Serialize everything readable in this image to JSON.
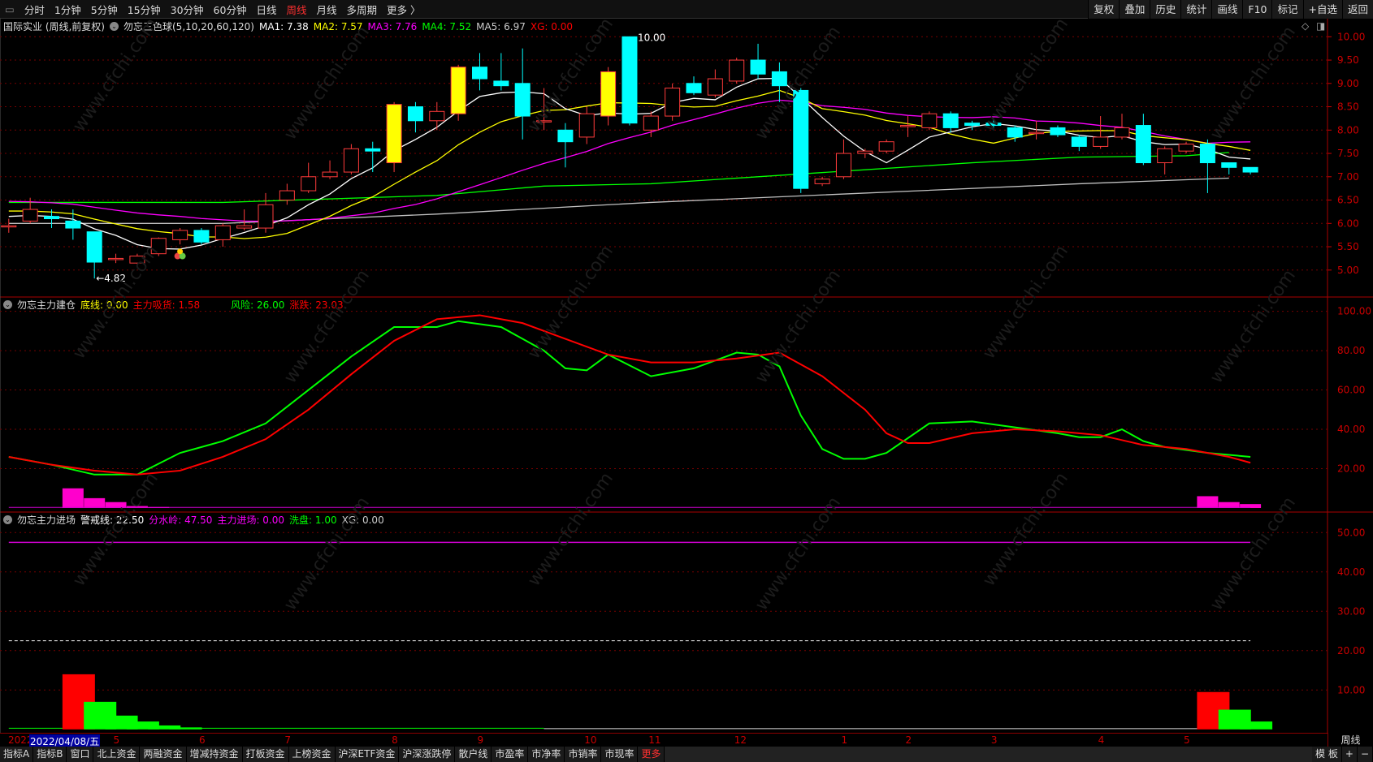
{
  "toolbar": {
    "tabs": [
      "分时",
      "1分钟",
      "5分钟",
      "15分钟",
      "30分钟",
      "60分钟",
      "日线",
      "周线",
      "月线",
      "多周期",
      "更多 〉"
    ],
    "active": "周线",
    "right": [
      "复权",
      "叠加",
      "历史",
      "统计",
      "画线",
      "F10",
      "标记",
      "+自选",
      "返回"
    ]
  },
  "price_legend": {
    "title": "国际实业 (周线,前复权)",
    "indicator": "勿忘三色球(5,10,20,60,120)",
    "ma1": "MA1: 7.38",
    "ma2": "MA2: 7.57",
    "ma3": "MA3: 7.76",
    "ma4": "MA4: 7.52",
    "ma5": "MA5: 6.97",
    "xg": "XG: 0.00"
  },
  "ind1_legend": {
    "title": "勿忘主力建仓",
    "dixian": "底线: 0.00",
    "xihuo": "主力吸货: 1.58",
    "fengxian": "风险: 26.00",
    "zhangdie": "涨跌: 23.03"
  },
  "ind2_legend": {
    "title": "勿忘主力进场",
    "jingjie": "警戒线: 22.50",
    "fenshuiling": "分水岭: 47.50",
    "jinchang": "主力进场: 0.00",
    "xipan": "洗盘: 1.00",
    "xg": "XG: 0.00"
  },
  "colors": {
    "up": "#ff3b3b",
    "down": "#00ffff",
    "limit": "#ffff00",
    "ma1": "#ffffff",
    "ma2": "#ffff00",
    "ma3": "#ff00ff",
    "ma4": "#00ff00",
    "ma5": "#c0c0c0",
    "axis": "#cc0000"
  },
  "chart_data": {
    "type": "candlestick",
    "price_axis": {
      "ticks": [
        "10.00",
        "9.50",
        "9.00",
        "8.50",
        "8.00",
        "7.50",
        "7.00",
        "6.50",
        "6.00",
        "5.50",
        "5.00"
      ],
      "range": [
        4.6,
        10.3
      ]
    },
    "annotations": {
      "high": "10.00",
      "low": "←4.82"
    },
    "candles": [
      [
        5.95,
        5.95,
        6.1,
        5.8
      ],
      [
        6.05,
        6.3,
        6.55,
        6.0
      ],
      [
        6.15,
        6.1,
        6.3,
        5.9
      ],
      [
        6.05,
        5.9,
        6.3,
        5.65
      ],
      [
        5.82,
        5.17,
        5.82,
        4.82
      ],
      [
        5.25,
        5.25,
        5.35,
        5.15
      ],
      [
        5.15,
        5.3,
        5.35,
        5.12
      ],
      [
        5.35,
        5.68,
        5.7,
        5.3
      ],
      [
        5.65,
        5.85,
        5.9,
        5.55
      ],
      [
        5.85,
        5.6,
        5.9,
        5.55
      ],
      [
        5.65,
        5.95,
        6.0,
        5.5
      ],
      [
        5.9,
        5.95,
        6.3,
        5.85
      ],
      [
        5.9,
        6.4,
        6.65,
        5.8
      ],
      [
        6.5,
        6.7,
        6.85,
        6.4
      ],
      [
        6.7,
        7.0,
        7.3,
        6.65
      ],
      [
        7.0,
        7.1,
        7.35,
        6.95
      ],
      [
        7.1,
        7.6,
        7.7,
        7.05
      ],
      [
        7.6,
        7.55,
        7.75,
        7.1
      ],
      [
        7.3,
        8.55,
        8.6,
        7.1
      ],
      [
        8.5,
        8.2,
        8.6,
        7.95
      ],
      [
        8.2,
        8.4,
        8.6,
        8.0
      ],
      [
        8.35,
        9.35,
        9.4,
        8.2
      ],
      [
        9.35,
        9.1,
        9.65,
        8.85
      ],
      [
        9.05,
        8.95,
        9.65,
        8.85
      ],
      [
        9.0,
        8.3,
        9.75,
        7.8
      ],
      [
        8.2,
        8.2,
        8.9,
        8.0
      ],
      [
        8.0,
        7.75,
        8.15,
        7.2
      ],
      [
        7.85,
        8.35,
        8.5,
        7.7
      ],
      [
        8.3,
        9.25,
        9.35,
        8.1
      ],
      [
        10.0,
        8.15,
        10.0,
        8.1
      ],
      [
        8.0,
        8.3,
        8.4,
        7.85
      ],
      [
        8.3,
        8.9,
        9.0,
        8.2
      ],
      [
        9.0,
        8.8,
        9.15,
        8.75
      ],
      [
        8.75,
        9.1,
        9.3,
        8.7
      ],
      [
        9.05,
        9.5,
        9.55,
        9.0
      ],
      [
        9.5,
        9.2,
        9.85,
        9.1
      ],
      [
        9.25,
        8.95,
        9.45,
        8.6
      ],
      [
        8.85,
        6.75,
        8.9,
        6.65
      ],
      [
        6.85,
        6.95,
        7.0,
        6.8
      ],
      [
        7.0,
        7.5,
        7.8,
        6.95
      ],
      [
        7.5,
        7.55,
        7.6,
        7.4
      ],
      [
        7.55,
        7.75,
        7.8,
        7.5
      ],
      [
        8.1,
        8.1,
        8.3,
        7.85
      ],
      [
        8.05,
        8.35,
        8.4,
        8.0
      ],
      [
        8.35,
        8.05,
        8.4,
        7.95
      ],
      [
        8.15,
        8.1,
        8.2,
        8.0
      ],
      [
        8.15,
        8.1,
        8.25,
        8.0
      ],
      [
        8.05,
        7.85,
        8.1,
        7.75
      ],
      [
        7.95,
        7.95,
        8.2,
        7.8
      ],
      [
        8.05,
        7.9,
        8.1,
        7.85
      ],
      [
        7.85,
        7.65,
        7.9,
        7.55
      ],
      [
        7.65,
        7.85,
        8.3,
        7.6
      ],
      [
        7.85,
        8.05,
        8.35,
        7.8
      ],
      [
        8.1,
        7.3,
        8.35,
        7.25
      ],
      [
        7.3,
        7.6,
        7.65,
        7.05
      ],
      [
        7.55,
        7.7,
        7.75,
        7.5
      ],
      [
        7.7,
        7.3,
        7.8,
        6.65
      ],
      [
        7.3,
        7.2,
        7.3,
        7.05
      ],
      [
        7.2,
        7.1,
        7.2,
        7.05
      ]
    ],
    "limit_up_index": [
      18,
      21,
      28
    ],
    "ma4": [
      [
        0,
        6.45
      ],
      [
        10,
        6.45
      ],
      [
        20,
        6.6
      ],
      [
        25,
        6.8
      ],
      [
        30,
        6.85
      ],
      [
        35,
        7.0
      ],
      [
        40,
        7.15
      ],
      [
        45,
        7.3
      ],
      [
        50,
        7.42
      ],
      [
        55,
        7.45
      ],
      [
        57,
        7.52
      ]
    ],
    "ma5": [
      [
        0,
        6.0
      ],
      [
        10,
        6.0
      ],
      [
        20,
        6.2
      ],
      [
        30,
        6.45
      ],
      [
        40,
        6.65
      ],
      [
        50,
        6.85
      ],
      [
        57,
        6.97
      ]
    ],
    "ind1": {
      "yticks": [
        "100.00",
        "80.00",
        "60.00",
        "40.00",
        "20.00"
      ],
      "range": [
        0,
        100
      ],
      "green": [
        [
          0,
          26
        ],
        [
          2,
          22
        ],
        [
          4,
          17
        ],
        [
          6,
          17
        ],
        [
          8,
          28
        ],
        [
          10,
          34
        ],
        [
          12,
          43
        ],
        [
          14,
          60
        ],
        [
          16,
          77
        ],
        [
          18,
          92
        ],
        [
          20,
          92
        ],
        [
          21,
          95
        ],
        [
          23,
          92
        ],
        [
          25,
          80
        ],
        [
          26,
          71
        ],
        [
          27,
          70
        ],
        [
          28,
          78
        ],
        [
          30,
          67
        ],
        [
          32,
          71
        ],
        [
          34,
          79
        ],
        [
          35,
          78
        ],
        [
          36,
          72
        ],
        [
          37,
          47
        ],
        [
          38,
          30
        ],
        [
          39,
          25
        ],
        [
          40,
          25
        ],
        [
          41,
          28
        ],
        [
          43,
          43
        ],
        [
          45,
          44
        ],
        [
          47,
          41
        ],
        [
          49,
          38
        ],
        [
          50,
          36
        ],
        [
          51,
          36
        ],
        [
          52,
          40
        ],
        [
          53,
          34
        ],
        [
          54,
          31
        ],
        [
          56,
          28
        ],
        [
          58,
          26
        ]
      ],
      "red": [
        [
          0,
          26
        ],
        [
          2,
          22
        ],
        [
          4,
          19
        ],
        [
          6,
          17
        ],
        [
          8,
          19
        ],
        [
          10,
          26
        ],
        [
          12,
          35
        ],
        [
          14,
          50
        ],
        [
          16,
          68
        ],
        [
          18,
          85
        ],
        [
          20,
          96
        ],
        [
          22,
          98
        ],
        [
          24,
          94
        ],
        [
          26,
          86
        ],
        [
          28,
          78
        ],
        [
          30,
          74
        ],
        [
          32,
          74
        ],
        [
          34,
          76
        ],
        [
          36,
          79
        ],
        [
          38,
          67
        ],
        [
          40,
          50
        ],
        [
          41,
          38
        ],
        [
          42,
          33
        ],
        [
          43,
          33
        ],
        [
          45,
          38
        ],
        [
          47,
          40
        ],
        [
          49,
          39
        ],
        [
          51,
          37
        ],
        [
          53,
          32
        ],
        [
          55,
          30
        ],
        [
          57,
          26
        ],
        [
          58,
          23
        ]
      ],
      "bars": [
        [
          3,
          10
        ],
        [
          4,
          5
        ],
        [
          5,
          3
        ],
        [
          6,
          1
        ],
        [
          7,
          0.5
        ],
        [
          56,
          6
        ],
        [
          57,
          3
        ],
        [
          58,
          2
        ]
      ]
    },
    "ind2": {
      "yticks": [
        "50.00",
        "40.00",
        "30.00",
        "20.00",
        "10.00"
      ],
      "range": [
        0,
        55
      ],
      "fenshuiling": 47.5,
      "jingjie": 22.5,
      "red_bars": [
        [
          3,
          14
        ],
        [
          56,
          9.5
        ]
      ],
      "green_bars": [
        [
          4,
          7
        ],
        [
          5,
          3.5
        ],
        [
          6,
          2
        ],
        [
          7,
          1
        ],
        [
          8,
          0.5
        ],
        [
          57,
          5
        ],
        [
          58,
          2
        ]
      ],
      "green_line_end": 25
    }
  },
  "date_axis": {
    "year": "2022",
    "selected": "2022/04/08/五",
    "months": [
      [
        "5",
        5
      ],
      [
        "6",
        9
      ],
      [
        "7",
        13
      ],
      [
        "8",
        18
      ],
      [
        "9",
        22
      ],
      [
        "10",
        27
      ],
      [
        "11",
        30
      ],
      [
        "12",
        34
      ],
      [
        "1",
        39
      ],
      [
        "2",
        42
      ],
      [
        "3",
        46
      ],
      [
        "4",
        51
      ],
      [
        "5",
        55
      ]
    ],
    "period": "周线"
  },
  "bottom_tabs": [
    "指标A",
    "指标B",
    "窗口",
    "北上资金",
    "两融资金",
    "增减持资金",
    "打板资金",
    "上榜资金",
    "沪深ETF资金",
    "沪深涨跌停",
    "散户线",
    "市盈率",
    "市净率",
    "市销率",
    "市现率",
    "更多"
  ],
  "bottom_right": [
    "模 板",
    "+",
    "−"
  ],
  "watermark": "www.cfchi.com"
}
